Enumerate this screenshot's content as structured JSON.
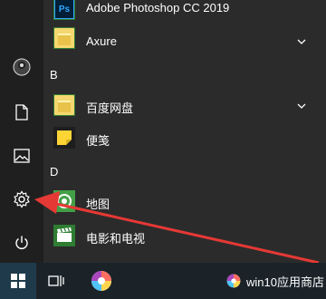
{
  "colors": {
    "tile_green": "#2e7d32",
    "tile_green_light": "#43a047",
    "rail_bg": "#1f1f1f",
    "list_bg": "#2b2b2b",
    "taskbar_bg": "#1b2329",
    "annotation_red": "#e53935",
    "ps_blue": "#31a8ff"
  },
  "start_menu": {
    "apps": [
      {
        "label": "Adobe Photoshop CC 2019",
        "icon": "photoshop-icon",
        "ps_text": "Ps",
        "expandable": false
      },
      {
        "label": "Axure",
        "icon": "folder-icon",
        "expandable": true
      },
      {
        "label": "百度网盘",
        "icon": "folder-icon",
        "expandable": true
      },
      {
        "label": "便笺",
        "icon": "sticky-notes-icon",
        "expandable": false
      },
      {
        "label": "地图",
        "icon": "maps-icon",
        "expandable": false
      },
      {
        "label": "电影和电视",
        "icon": "movies-tv-icon",
        "expandable": false
      }
    ],
    "letters": [
      "B",
      "D"
    ]
  },
  "rail": {
    "items": [
      "user-avatar-icon",
      "document-icon",
      "pictures-icon",
      "settings-icon",
      "power-icon"
    ]
  },
  "taskbar": {
    "app_store_label": "win10应用商店"
  }
}
